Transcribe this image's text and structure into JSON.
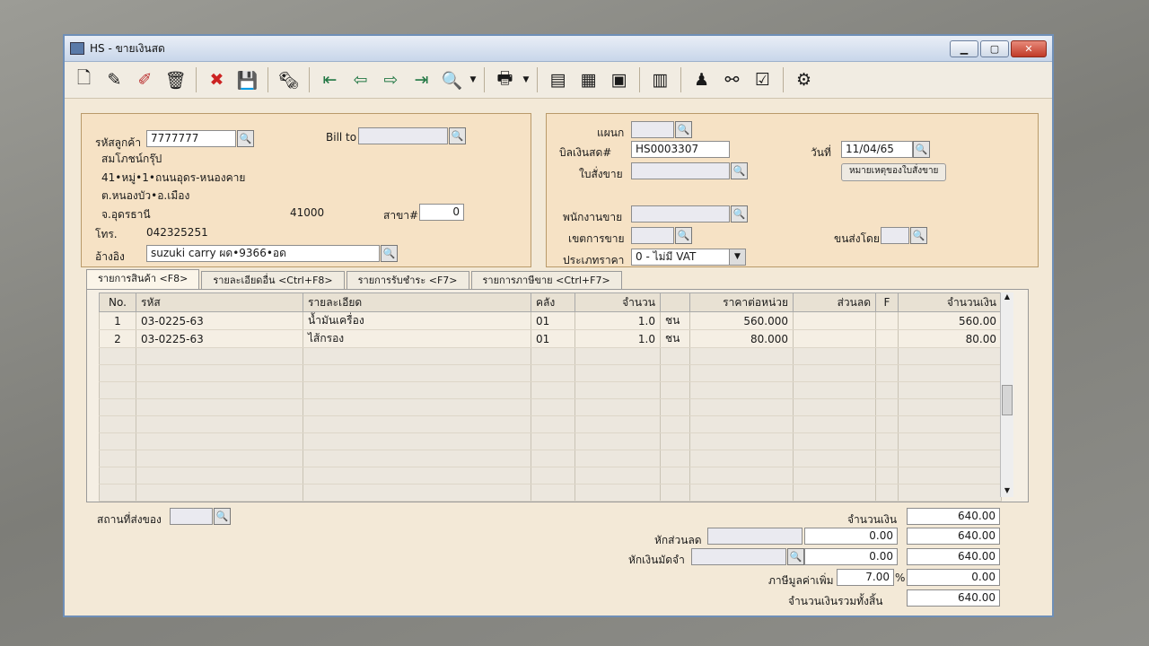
{
  "window": {
    "title": "HS - ขายเงินสด"
  },
  "toolbar": {
    "icons": [
      "new-icon",
      "edit-icon",
      "delete-icon",
      "trash-icon",
      "cancel-icon",
      "save-icon",
      "print-preview-icon",
      "first-icon",
      "prev-icon",
      "next-icon",
      "last-icon",
      "search-icon",
      "printer-icon",
      "report-icon",
      "list-icon",
      "export-icon",
      "calc-icon",
      "approve-icon",
      "link-icon",
      "ok-icon",
      "tool-icon"
    ]
  },
  "customer": {
    "code_label": "รหัสลูกค้า",
    "code": "7777777",
    "name": "สมโภชน์กรุ๊ป",
    "addr1": "41•หมู่•1•ถนนอุดร-หนองคาย",
    "addr2": "ต.หนองบัว•อ.เมือง",
    "addr3": "จ.อุดรธานี",
    "zip": "41000",
    "branch_label": "สาขา#",
    "branch": "0",
    "tel_label": "โทร.",
    "tel": "042325251",
    "ref_label": "อ้างอิง",
    "ref": "suzuki carry ผด•9366•อด",
    "billto_label": "Bill to"
  },
  "doc": {
    "dept_label": "แผนก",
    "bill_label": "บิลเงินสด#",
    "bill_no": "HS0003307",
    "date_label": "วันที่",
    "date": "11/04/65",
    "order_label": "ใบสั่งขาย",
    "note_button": "หมายเหตุของใบสั่งขาย",
    "salesman_label": "พนักงานขาย",
    "area_label": "เขตการขาย",
    "ship_label": "ขนส่งโดย",
    "price_type_label": "ประเภทราคา",
    "price_type": "0 - ไม่มี VAT"
  },
  "tabs": [
    "รายการสินค้า <F8>",
    "รายละเอียดอื่น <Ctrl+F8>",
    "รายการรับชำระ <F7>",
    "รายการภาษีขาย <Ctrl+F7>"
  ],
  "grid": {
    "headers": [
      "No.",
      "รหัส",
      "รายละเอียด",
      "คลัง",
      "จำนวน",
      "",
      "ราคาต่อหน่วย",
      "ส่วนลด",
      "F",
      "จำนวนเงิน"
    ],
    "rows": [
      [
        "1",
        "03-0225-63",
        "น้ำมันเครื่อง",
        "01",
        "1.0",
        "ชน",
        "560.000",
        "",
        "",
        "560.00"
      ],
      [
        "2",
        "03-0225-63",
        "ไส้กรอง",
        "01",
        "1.0",
        "ชน",
        "80.000",
        "",
        "",
        "80.00"
      ]
    ]
  },
  "footer": {
    "ship_place_label": "สถานที่ส่งของ",
    "amount_label": "จำนวนเงิน",
    "amount": "640.00",
    "discount_label": "หักส่วนลด",
    "discount": "0.00",
    "after_discount": "640.00",
    "deposit_label": "หักเงินมัดจำ",
    "deposit": "0.00",
    "after_deposit": "640.00",
    "vat_label": "ภาษีมูลค่าเพิ่ม",
    "vat_rate": "7.00",
    "vat_pct": "%",
    "vat": "0.00",
    "total_label": "จำนวนเงินรวมทั้งสิ้น",
    "total": "640.00"
  }
}
